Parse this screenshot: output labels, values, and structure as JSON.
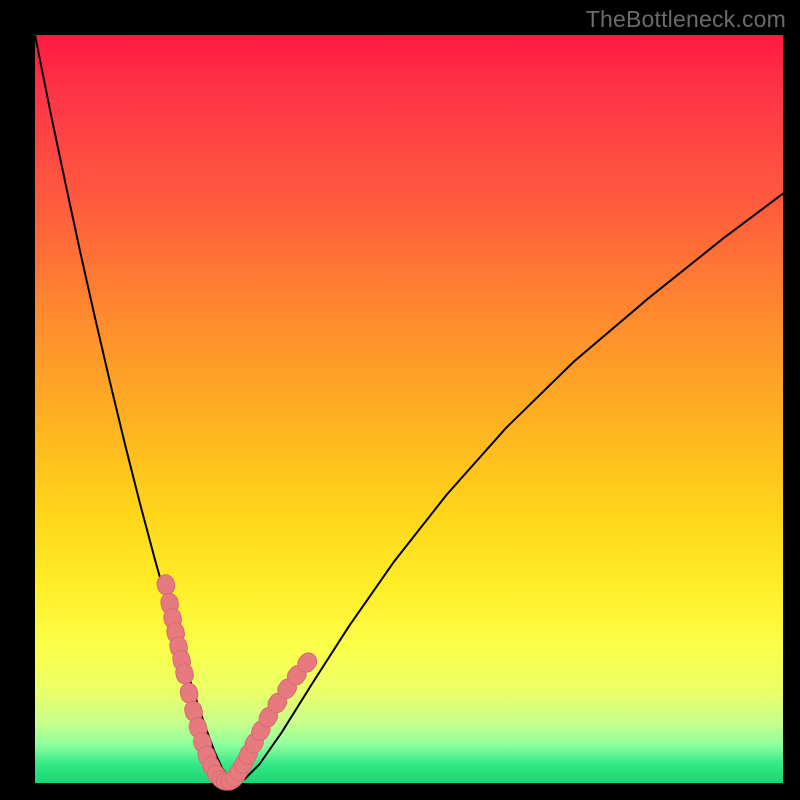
{
  "watermark": "TheBottleneck.com",
  "colors": {
    "frame": "#000000",
    "curve": "#000000",
    "marker_fill": "#e77a7f",
    "marker_stroke": "#d86a70"
  },
  "chart_data": {
    "type": "line",
    "title": "",
    "xlabel": "",
    "ylabel": "",
    "xlim": [
      0,
      100
    ],
    "ylim": [
      0,
      100
    ],
    "grid": false,
    "series": [
      {
        "name": "bottleneck-curve",
        "x": [
          0,
          2,
          4,
          6,
          8,
          10,
          12,
          14,
          16,
          18,
          19,
          20,
          21,
          22,
          23,
          24,
          25,
          26,
          27,
          28,
          30,
          33,
          37,
          42,
          48,
          55,
          63,
          72,
          82,
          92,
          100
        ],
        "y": [
          100,
          90,
          80.5,
          71.2,
          62.3,
          53.7,
          45.4,
          37.5,
          30,
          22.9,
          19.5,
          16.1,
          12.9,
          9.8,
          6.9,
          4.2,
          2.0,
          0.7,
          0.15,
          0.5,
          2.5,
          6.8,
          13.2,
          21.0,
          29.6,
          38.5,
          47.5,
          56.3,
          64.8,
          72.8,
          78.8
        ]
      }
    ],
    "markers": {
      "name": "highlighted-points",
      "x": [
        17.5,
        18.0,
        18.4,
        18.8,
        19.2,
        19.6,
        20.0,
        20.6,
        21.2,
        21.8,
        22.4,
        23.0,
        23.6,
        24.3,
        25.0,
        25.6,
        26.2,
        26.8,
        27.3,
        27.9,
        28.5,
        29.3,
        30.2,
        31.2,
        32.4,
        33.7,
        35.0,
        36.4
      ],
      "y": [
        26.5,
        24.0,
        22.0,
        20.1,
        18.2,
        16.4,
        14.6,
        12.0,
        9.6,
        7.4,
        5.4,
        3.6,
        2.2,
        1.1,
        0.4,
        0.2,
        0.3,
        0.8,
        1.6,
        2.6,
        3.8,
        5.3,
        7.0,
        8.8,
        10.7,
        12.6,
        14.4,
        16.1
      ]
    }
  }
}
